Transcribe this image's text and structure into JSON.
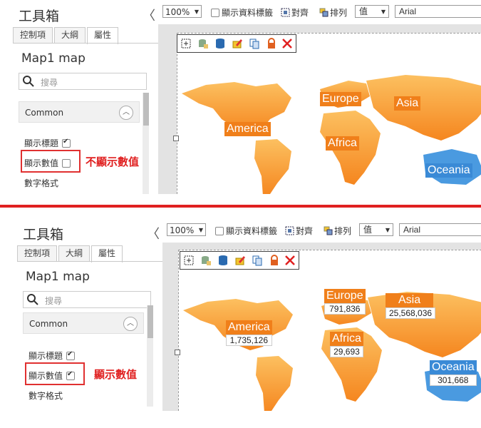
{
  "toolbox": {
    "title": "工具箱",
    "collapse_glyph": "〈",
    "tabs": [
      {
        "label": "控制項",
        "active": false
      },
      {
        "label": "大綱",
        "active": false
      },
      {
        "label": "屬性",
        "active": true
      }
    ],
    "object_name": "Map1 map",
    "search_placeholder": "搜尋",
    "section_title": "Common",
    "section_toggle": "^",
    "props": {
      "show_title": "顯示標題",
      "show_value": "顯示數值",
      "number_format": "數字格式"
    }
  },
  "toolbar": {
    "zoom": "100%",
    "show_data_label": "顯示資料標籤",
    "align": "對齊",
    "arrange": "排列",
    "value_select": "值",
    "font_select": "Arial"
  },
  "colors": {
    "land": "#fbb13c",
    "land_dark": "#f58220",
    "label_bg": "#f07f1a",
    "oceania_bg": "#3a8ad6",
    "annotation": "#e02020"
  },
  "top": {
    "show_title_checked": true,
    "show_value_checked": false,
    "annotation": "不顯示數值",
    "continents": {
      "america": {
        "name": "America"
      },
      "europe": {
        "name": "Europe"
      },
      "asia": {
        "name": "Asia"
      },
      "africa": {
        "name": "Africa"
      },
      "oceania": {
        "name": "Oceania"
      }
    }
  },
  "bottom": {
    "show_title_checked": true,
    "show_value_checked": true,
    "annotation": "顯示數值",
    "continents": {
      "america": {
        "name": "America",
        "value": "1,735,126"
      },
      "europe": {
        "name": "Europe",
        "value": "791,836"
      },
      "asia": {
        "name": "Asia",
        "value": "25,568,036"
      },
      "africa": {
        "name": "Africa",
        "value": "29,693"
      },
      "oceania": {
        "name": "Oceania",
        "value": "301,668"
      }
    }
  }
}
